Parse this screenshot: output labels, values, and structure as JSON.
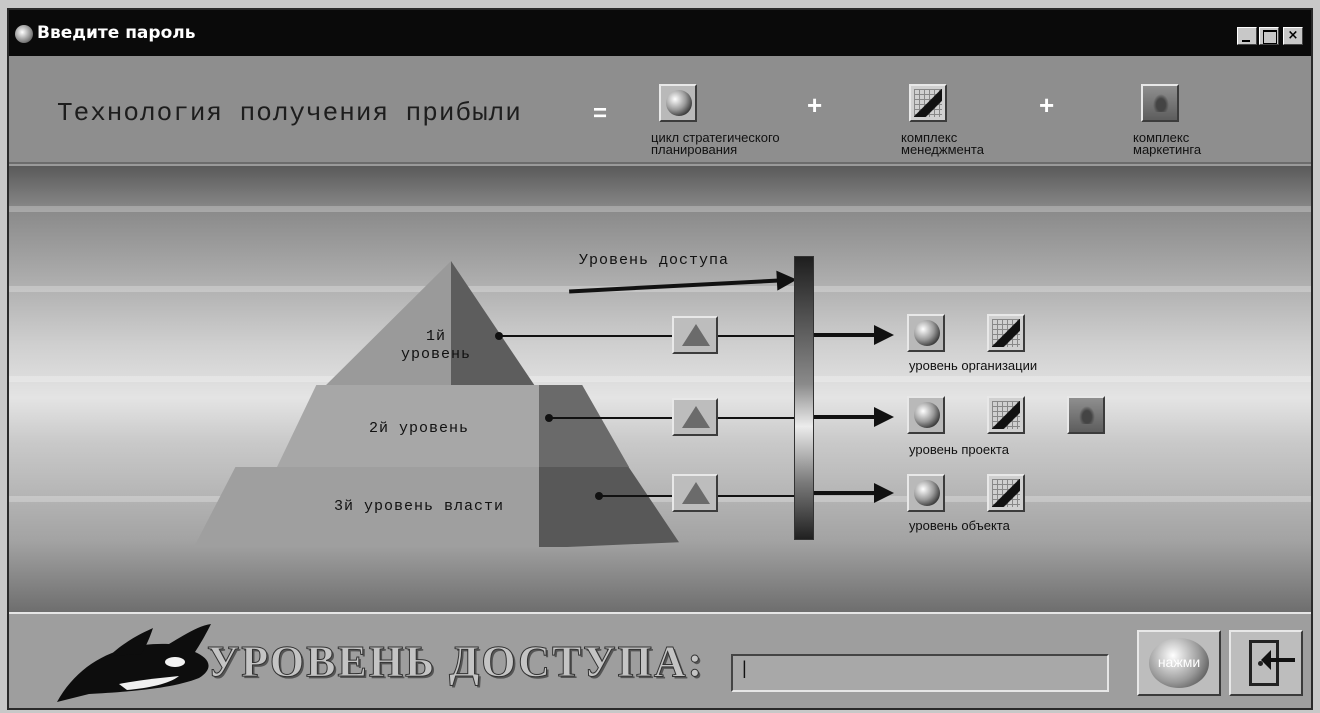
{
  "window": {
    "title": "Введите пароль",
    "icon": "orca-icon",
    "buttons": {
      "minimize": "minimize",
      "maximize": "maximize",
      "close": "×"
    }
  },
  "header": {
    "formula": "Технология получения прибыли",
    "equals": "=",
    "plus": "+",
    "items": [
      {
        "icon": "globe-icon",
        "caption_line1": "цикл стратегического",
        "caption_line2": "планирования"
      },
      {
        "icon": "chart-icon",
        "caption_line1": "комплекс",
        "caption_line2": "менеджмента"
      },
      {
        "icon": "marketing-icon",
        "caption_line1": "комплекс",
        "caption_line2": "маркетинга"
      }
    ]
  },
  "scene": {
    "access_label": "Уровень доступа",
    "pyramid": {
      "level1_line1": "1й",
      "level1_line2": "уровень",
      "level2": "2й уровень",
      "level3": "3й уровень власти"
    },
    "levels": [
      {
        "caption": "уровень организации",
        "icons": [
          "globe-icon",
          "chart-icon"
        ]
      },
      {
        "caption": "уровень проекта",
        "icons": [
          "globe-icon",
          "chart-icon",
          "marketing-icon"
        ]
      },
      {
        "caption": "уровень объекта",
        "icons": [
          "globe-icon",
          "chart-icon"
        ]
      }
    ]
  },
  "footer": {
    "access_title": "УРОВЕНЬ ДОСТУПА:",
    "password_value": "|",
    "press_button": "нажми",
    "exit_icon": "exit-door-icon"
  }
}
